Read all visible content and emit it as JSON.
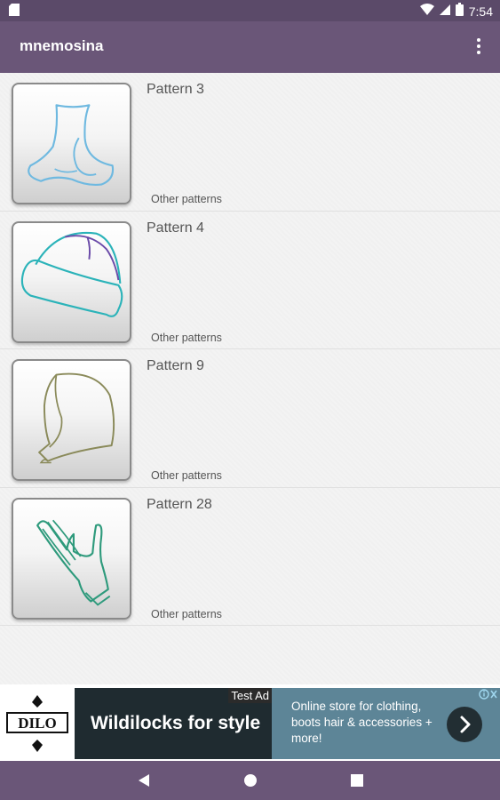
{
  "status_bar": {
    "time": "7:54",
    "icons": [
      "sd-card-icon",
      "wifi-icon",
      "cell-signal-icon",
      "battery-icon"
    ]
  },
  "app_bar": {
    "title": "mnemosina",
    "menu_icon": "overflow-menu-icon"
  },
  "patterns": [
    {
      "title": "Pattern 3",
      "subtitle": "Other patterns",
      "thumbnail": "sock-icon",
      "color": "#6fb9e0"
    },
    {
      "title": "Pattern 4",
      "subtitle": "Other patterns",
      "thumbnail": "beanie-hat-icon",
      "color": "#2bb3b9"
    },
    {
      "title": "Pattern 9",
      "subtitle": "Other patterns",
      "thumbnail": "hood-icon",
      "color": "#8a8a5a"
    },
    {
      "title": "Pattern 28",
      "subtitle": "Other patterns",
      "thumbnail": "glove-icon",
      "color": "#2e9a7c"
    }
  ],
  "ad": {
    "brand": "DILO",
    "test_label": "Test Ad",
    "headline": "Wildilocks for style",
    "description": "Online store for clothing, boots hair & accessories + more!",
    "cta_icon": "chevron-right-icon",
    "colors": {
      "main": "#1f2b30",
      "side": "#5d8597"
    }
  },
  "nav_bar": {
    "buttons": [
      "back-icon",
      "home-icon",
      "recents-icon"
    ]
  },
  "colors": {
    "status_bar": "#5b4a69",
    "app_bar": "#6a5678",
    "list_background": "#f3f3f3"
  }
}
